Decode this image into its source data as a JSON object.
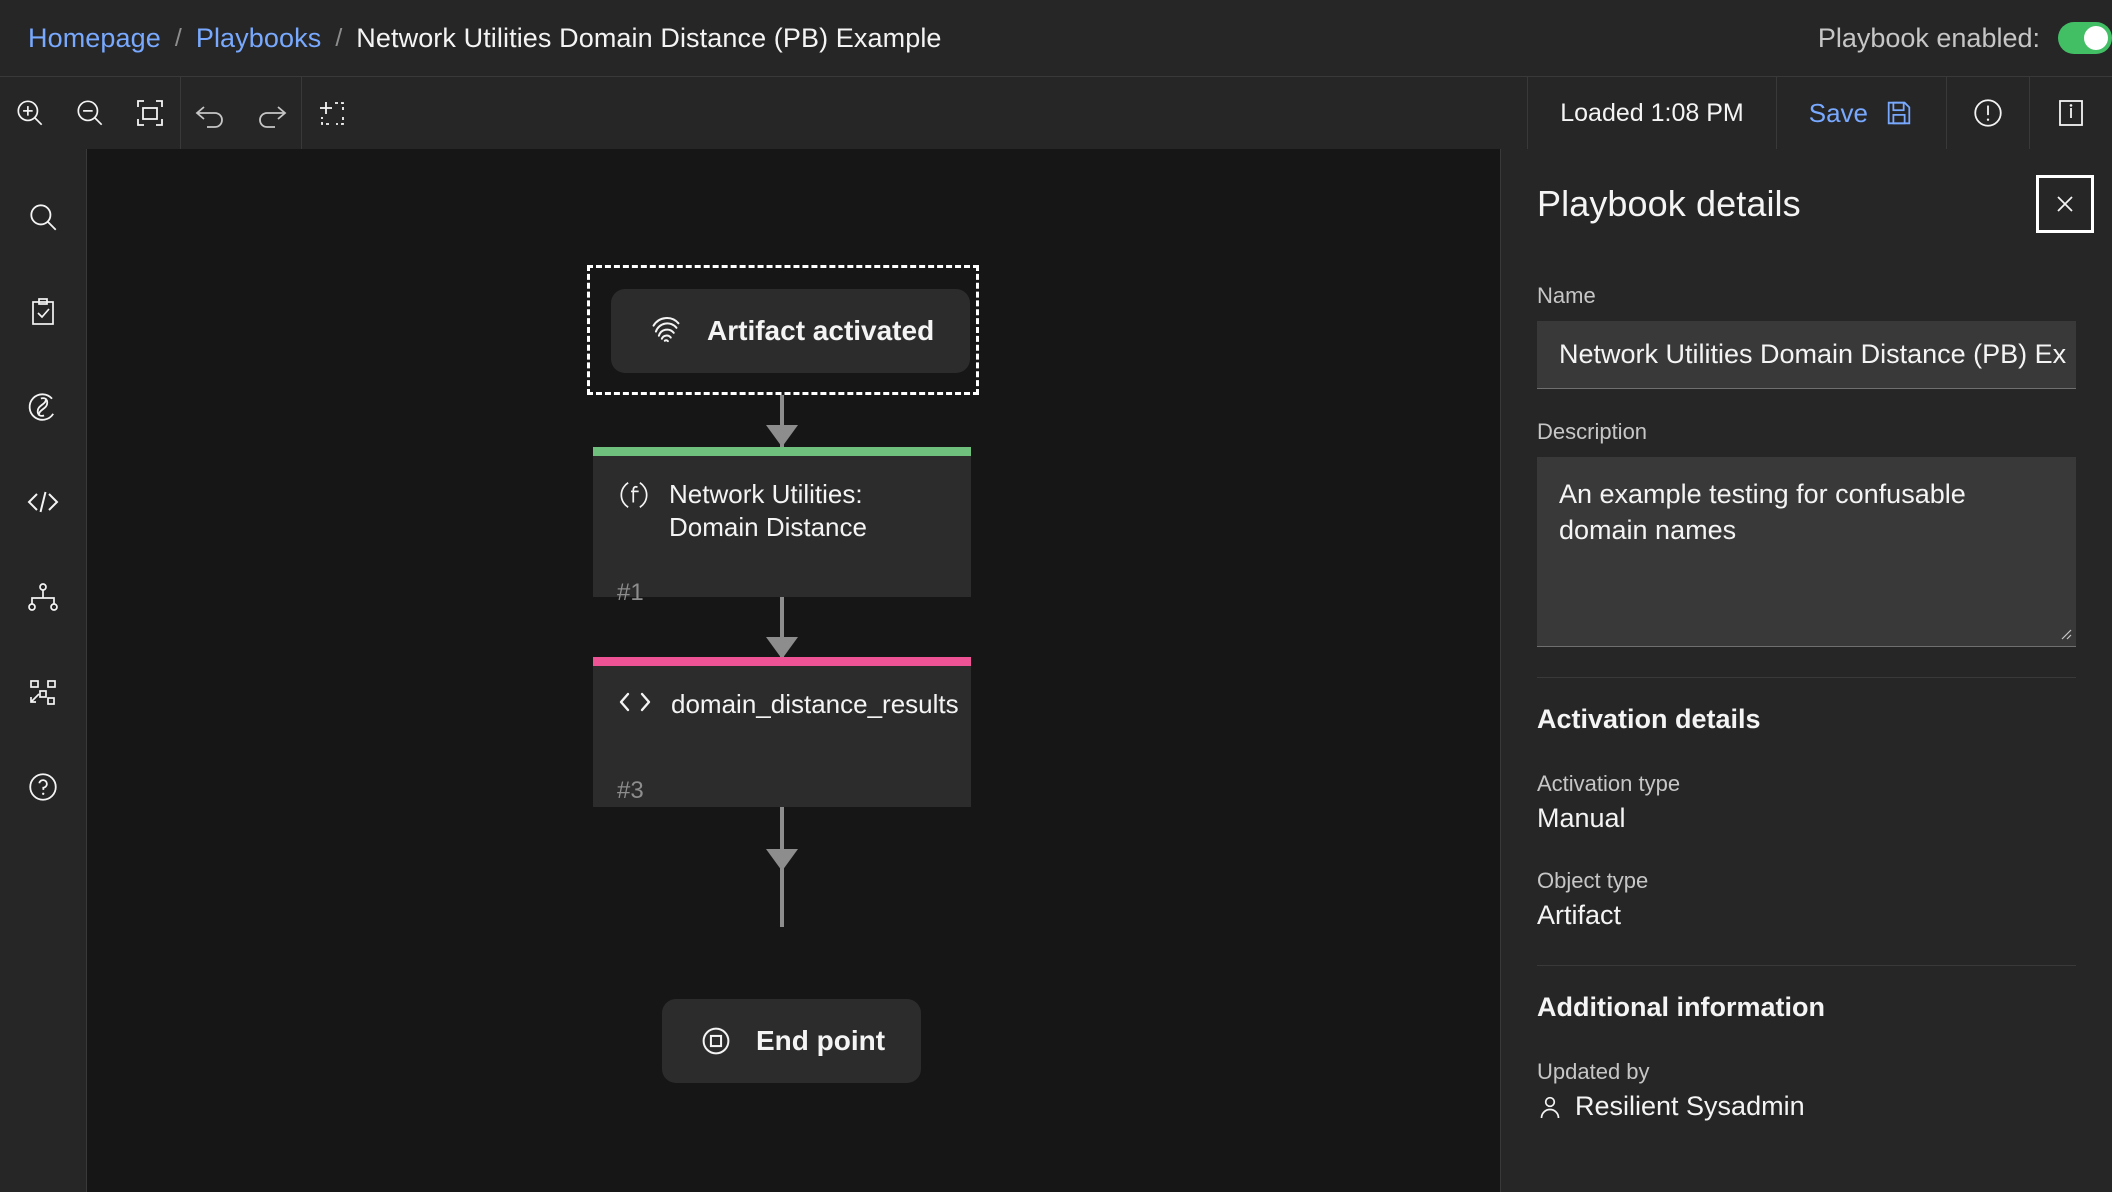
{
  "breadcrumb": {
    "items": [
      {
        "label": "Homepage",
        "link": true
      },
      {
        "label": "Playbooks",
        "link": true
      },
      {
        "label": "Network Utilities Domain Distance (PB) Example",
        "link": false
      }
    ],
    "separator": "/"
  },
  "header": {
    "enabled_label": "Playbook enabled:",
    "enabled_state": "on",
    "toggle_color": "#42be65"
  },
  "toolbar": {
    "zoom_in": "zoom-in-icon",
    "zoom_out": "zoom-out-icon",
    "fit_to_screen": "fit-to-screen-icon",
    "undo": "undo-icon",
    "redo": "redo-icon",
    "select_area": "select-area-icon",
    "loaded_text": "Loaded 1:08 PM",
    "save_label": "Save",
    "save_icon": "save-disk-icon",
    "save_color": "#78a9ff",
    "warning_icon": "warning-circle-icon",
    "details_panel_icon": "side-panel-icon"
  },
  "rail": {
    "items": [
      {
        "name": "search",
        "icon": "search-icon"
      },
      {
        "name": "tasks",
        "icon": "clipboard-check-icon"
      },
      {
        "name": "function",
        "icon": "function-lightning-icon"
      },
      {
        "name": "script",
        "icon": "code-icon"
      },
      {
        "name": "decision",
        "icon": "decision-tree-icon"
      },
      {
        "name": "subplaybook",
        "icon": "subflow-icon"
      },
      {
        "name": "help",
        "icon": "help-circle-icon"
      }
    ]
  },
  "canvas": {
    "nodes": [
      {
        "id": "start",
        "type": "pill",
        "label": "Artifact activated",
        "icon": "fingerprint-icon",
        "selected": true
      },
      {
        "id": "fn",
        "type": "card",
        "label": "Network Utilities: Domain Distance",
        "number": "#1",
        "icon": "function-icon",
        "bar_color": "#6fbf7d"
      },
      {
        "id": "script",
        "type": "card",
        "label": "domain_distance_results",
        "number": "#3",
        "icon": "code-icon",
        "bar_color": "#ee5396"
      },
      {
        "id": "end",
        "type": "pill",
        "label": "End point",
        "icon": "end-point-icon",
        "selected": false
      }
    ],
    "connector_color": "#8d8d8d"
  },
  "panel": {
    "title": "Playbook details",
    "close_icon": "close-icon",
    "name_label": "Name",
    "name_value": "Network Utilities Domain Distance (PB) Ex",
    "description_label": "Description",
    "description_value": "An example testing for confusable domain names",
    "activation_section": "Activation details",
    "activation_type_label": "Activation type",
    "activation_type_value": "Manual",
    "object_type_label": "Object type",
    "object_type_value": "Artifact",
    "additional_section": "Additional information",
    "updated_by_label": "Updated by",
    "updated_by_value": "Resilient Sysadmin",
    "updated_by_icon": "user-icon"
  }
}
